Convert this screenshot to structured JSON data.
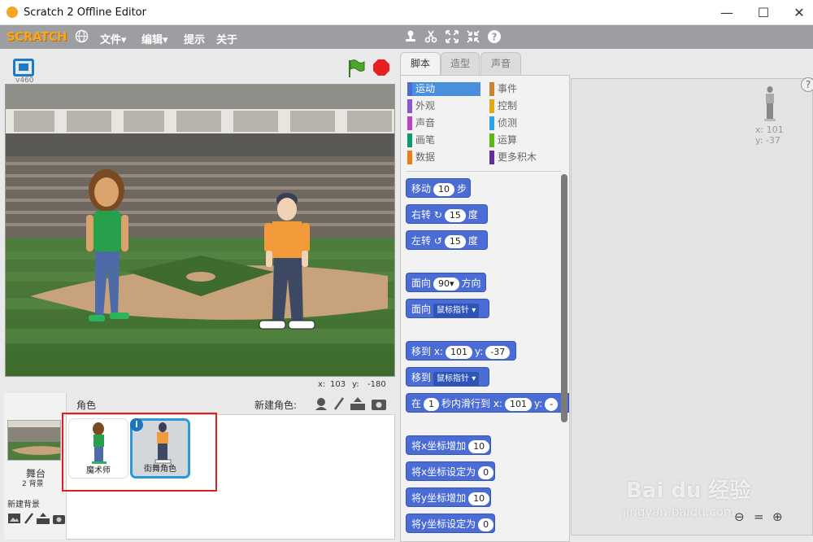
{
  "window": {
    "title": "Scratch 2 Offline Editor",
    "minimize": "—",
    "maximize": "☐",
    "close": "✕"
  },
  "menubar": {
    "logo": "SCRATCH",
    "items": [
      "文件▾",
      "编辑▾",
      "提示",
      "关于"
    ]
  },
  "stage": {
    "version": "v460",
    "mouse_x_label": "x:",
    "mouse_x": "103",
    "mouse_y_label": "y:",
    "mouse_y": "-180"
  },
  "sprite_pane": {
    "sprites_label": "角色",
    "new_sprite_label": "新建角色:",
    "stage_label": "舞台",
    "backdrop_count": "2 背景",
    "new_backdrop_label": "新建背景",
    "sprites": [
      {
        "name": "魔术师"
      },
      {
        "name": "街舞角色"
      }
    ]
  },
  "tabs": [
    "脚本",
    "造型",
    "声音"
  ],
  "categories": [
    {
      "label": "运动",
      "color": "#4a6cd4"
    },
    {
      "label": "事件",
      "color": "#c88330"
    },
    {
      "label": "外观",
      "color": "#8a55d7"
    },
    {
      "label": "控制",
      "color": "#e1a91a"
    },
    {
      "label": "声音",
      "color": "#bb42c3"
    },
    {
      "label": "侦测",
      "color": "#2ca5e2"
    },
    {
      "label": "画笔",
      "color": "#0e9a6c"
    },
    {
      "label": "运算",
      "color": "#5cb712"
    },
    {
      "label": "数据",
      "color": "#ee7d16"
    },
    {
      "label": "更多积木",
      "color": "#632d99"
    }
  ],
  "blocks": {
    "move": {
      "a": "移动",
      "v": "10",
      "b": "步"
    },
    "turn_right": {
      "a": "右转",
      "v": "15",
      "b": "度"
    },
    "turn_left": {
      "a": "左转",
      "v": "15",
      "b": "度"
    },
    "point_dir": {
      "a": "面向",
      "v": "90▾",
      "b": "方向"
    },
    "point_towards": {
      "a": "面向",
      "v": "鼠标指针 ▾"
    },
    "goto_xy": {
      "a": "移到 x:",
      "x": "101",
      "b": "y:",
      "y": "-37"
    },
    "goto": {
      "a": "移到",
      "v": "鼠标指针 ▾"
    },
    "glide": {
      "a": "在",
      "v": "1",
      "b": "秒内滑行到 x:",
      "x": "101",
      "c": "y:",
      "y": "-"
    },
    "change_x": {
      "a": "将x坐标增加",
      "v": "10"
    },
    "set_x": {
      "a": "将x坐标设定为",
      "v": "0"
    },
    "change_y": {
      "a": "将y坐标增加",
      "v": "10"
    },
    "set_y": {
      "a": "将y坐标设定为",
      "v": "0"
    }
  },
  "scripts_area": {
    "x_label": "x:",
    "x": "101",
    "y_label": "y:",
    "y": "-37"
  },
  "watermark": {
    "brand": "Bai du 经验",
    "url": "jingyan.baidu.com"
  }
}
